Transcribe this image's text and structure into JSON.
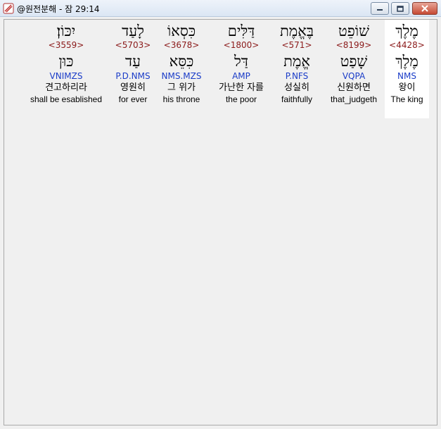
{
  "window": {
    "title": "@원전분해 - 잠 29:14"
  },
  "columns": [
    {
      "hebrew": "יִכּוֹן׃",
      "strong": "<3559>",
      "lemma": "כּוּן",
      "morph": "VNIMZS",
      "korean": "견고하리라",
      "english": "shall be esablished"
    },
    {
      "hebrew": "לָעַד",
      "strong": "<5703>",
      "lemma": "עַד",
      "morph": "P.D.NMS",
      "korean": "영원히",
      "english": "for ever"
    },
    {
      "hebrew": "כִּסְאוֹ",
      "strong": "<3678>",
      "lemma": "כִּסֵּא",
      "morph": "NMS.MZS",
      "korean": "그 위가",
      "english": "his throne"
    },
    {
      "hebrew": "דַּלִּים",
      "strong": "<1800>",
      "lemma": "דַּל",
      "morph": "AMP",
      "korean": "가난한 자를",
      "english": "the poor"
    },
    {
      "hebrew": "בֶּאֱמֶת",
      "strong": "<571>",
      "lemma": "אֱמֶת",
      "morph": "P.NFS",
      "korean": "성실히",
      "english": "faithfully"
    },
    {
      "hebrew": "שׁוֹפֵט",
      "strong": "<8199>",
      "lemma": "שָׁפַט",
      "morph": "VQPA",
      "korean": "신원하면",
      "english": "that_judgeth"
    },
    {
      "hebrew": "מֶלֶךְ",
      "strong": "<4428>",
      "lemma": "מֶלֶךְ",
      "morph": "NMS",
      "korean": "왕이",
      "english": "The king"
    }
  ]
}
